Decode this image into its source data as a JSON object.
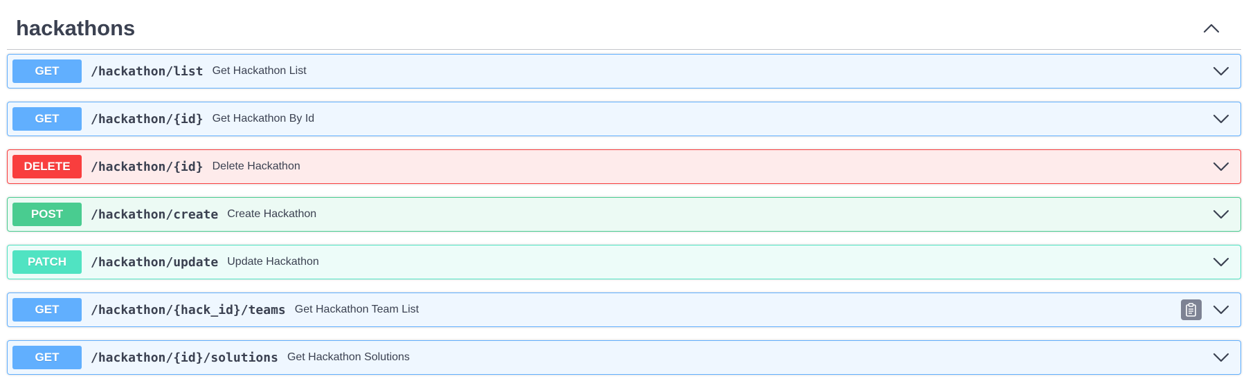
{
  "section": {
    "title": "hackathons"
  },
  "operations": [
    {
      "method": "GET",
      "path": "/hackathon/list",
      "summary": "Get Hackathon List"
    },
    {
      "method": "GET",
      "path": "/hackathon/{id}",
      "summary": "Get Hackathon By Id"
    },
    {
      "method": "DELETE",
      "path": "/hackathon/{id}",
      "summary": "Delete Hackathon"
    },
    {
      "method": "POST",
      "path": "/hackathon/create",
      "summary": "Create Hackathon"
    },
    {
      "method": "PATCH",
      "path": "/hackathon/update",
      "summary": "Update Hackathon"
    },
    {
      "method": "GET",
      "path": "/hackathon/{hack_id}/teams",
      "summary": "Get Hackathon Team List"
    },
    {
      "method": "GET",
      "path": "/hackathon/{id}/solutions",
      "summary": "Get Hackathon Solutions"
    }
  ],
  "colors": {
    "get": "#61affe",
    "delete": "#f93e3e",
    "post": "#49cc90",
    "patch": "#50e3c2",
    "text": "#3b4151"
  },
  "icons": {
    "collapse": "chevron-up-icon",
    "expand": "chevron-down-icon",
    "copy": "copy-to-clipboard-icon"
  }
}
